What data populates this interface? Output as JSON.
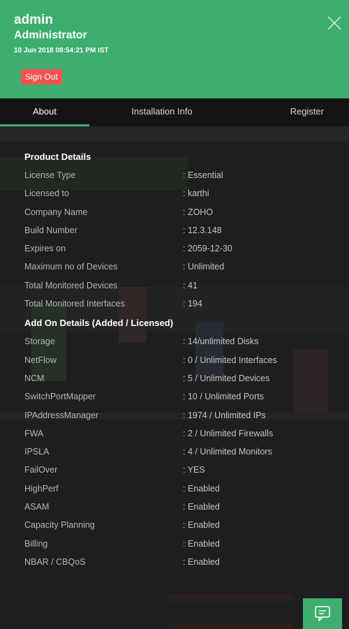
{
  "header": {
    "user": "admin",
    "role": "Administrator",
    "timestamp": "10 Jun 2018 08:54:21 PM IST",
    "signout_label": "Sign Out"
  },
  "tabs": [
    {
      "label": "About",
      "active": true
    },
    {
      "label": "Installation Info",
      "active": false
    },
    {
      "label": "Register",
      "active": false
    }
  ],
  "product": {
    "title": "Product Details",
    "rows": [
      {
        "key": "License Type",
        "value": ": Essential"
      },
      {
        "key": "Licensed to",
        "value": ": karthi"
      },
      {
        "key": "Company Name",
        "value": ": ZOHO"
      },
      {
        "key": "Build Number",
        "value": ": 12.3.148"
      },
      {
        "key": "Expires on",
        "value": ": 2059-12-30"
      },
      {
        "key": "Maximum no of Devices",
        "value": ": Unlimited"
      },
      {
        "key": "Total Monitored Devices",
        "value": ": 41"
      },
      {
        "key": "Total Monitored Interfaces",
        "value": ": 194"
      }
    ]
  },
  "addons": {
    "title": "Add On Details  (Added / Licensed)",
    "rows": [
      {
        "key": "Storage",
        "value": ": 14/unlimited Disks"
      },
      {
        "key": "NetFlow",
        "value": ": 0 / Unlimited Interfaces"
      },
      {
        "key": "NCM",
        "value": ": 5 / Unlimited Devices"
      },
      {
        "key": "SwitchPortMapper",
        "value": ": 10 / Unlimited Ports"
      },
      {
        "key": "IPAddressManager",
        "value": ": 1974 / Unlimited IPs"
      },
      {
        "key": "FWA",
        "value": ": 2 / Unlimited Firewalls"
      },
      {
        "key": "IPSLA",
        "value": ": 4 / Unlimited Monitors"
      },
      {
        "key": "FailOver",
        "value": ": YES"
      },
      {
        "key": "HighPerf",
        "value": ": Enabled"
      },
      {
        "key": "ASAM",
        "value": ": Enabled"
      },
      {
        "key": "Capacity Planning",
        "value": ": Enabled"
      },
      {
        "key": "Billing",
        "value": ": Enabled"
      },
      {
        "key": "NBAR / CBQoS",
        "value": ": Enabled"
      }
    ]
  },
  "colors": {
    "accent": "#3dae6f",
    "signout": "#ef5350",
    "panel_bg": "#1e1e1e"
  },
  "icons": {
    "close": "close-icon",
    "chat": "chat-icon"
  }
}
